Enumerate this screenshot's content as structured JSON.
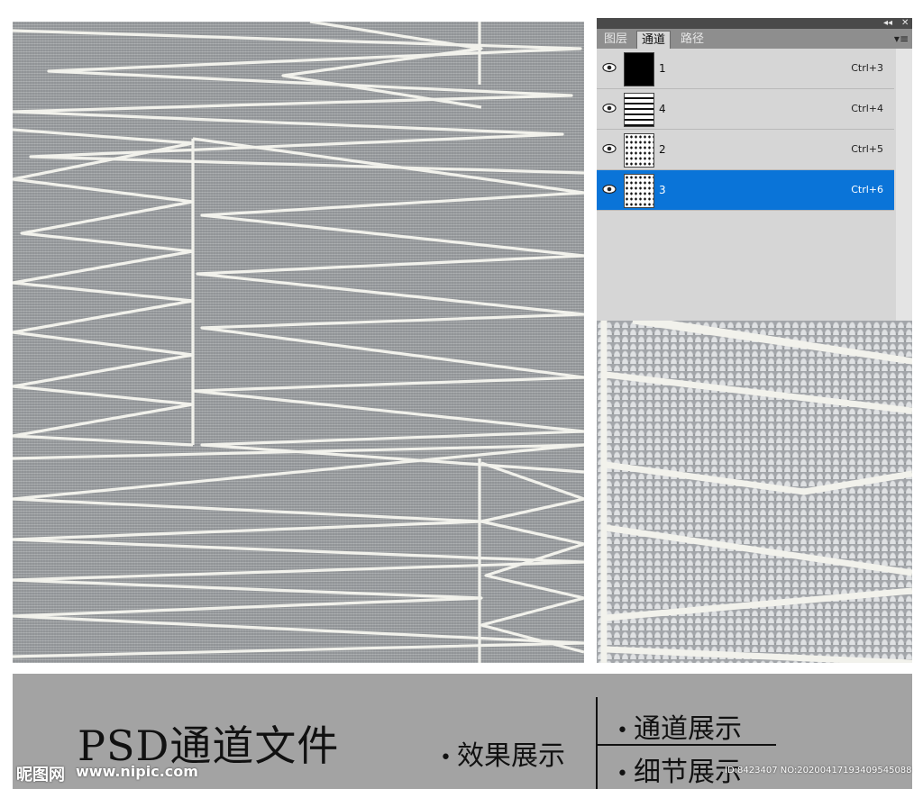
{
  "panel": {
    "window_controls": [
      "◂◂",
      "✕"
    ],
    "tabs": [
      {
        "label": "图层",
        "active": false
      },
      {
        "label": "通道",
        "active": true
      },
      {
        "label": "路径",
        "active": false
      }
    ],
    "menu_icon": "panel-menu-icon",
    "channels": [
      {
        "name": "1",
        "shortcut": "Ctrl+3",
        "thumb": "black",
        "selected": false
      },
      {
        "name": "4",
        "shortcut": "Ctrl+4",
        "thumb": "stripe",
        "selected": false
      },
      {
        "name": "2",
        "shortcut": "Ctrl+5",
        "thumb": "speckle",
        "selected": false
      },
      {
        "name": "3",
        "shortcut": "Ctrl+6",
        "thumb": "speckle",
        "selected": true
      }
    ],
    "selection_color": "#0a74d8"
  },
  "footer": {
    "title": "PSD通道文件",
    "bullets": [
      "效果展示",
      "通道展示",
      "细节展示"
    ]
  },
  "watermark": {
    "logo": "昵图网",
    "url": "www.nipic.com",
    "id_text": "ID:8423407 NO:20200417193409545088"
  },
  "colors": {
    "texture": "#9c9fa2",
    "line": "#f2f2ec",
    "footer": "#a3a3a3"
  }
}
